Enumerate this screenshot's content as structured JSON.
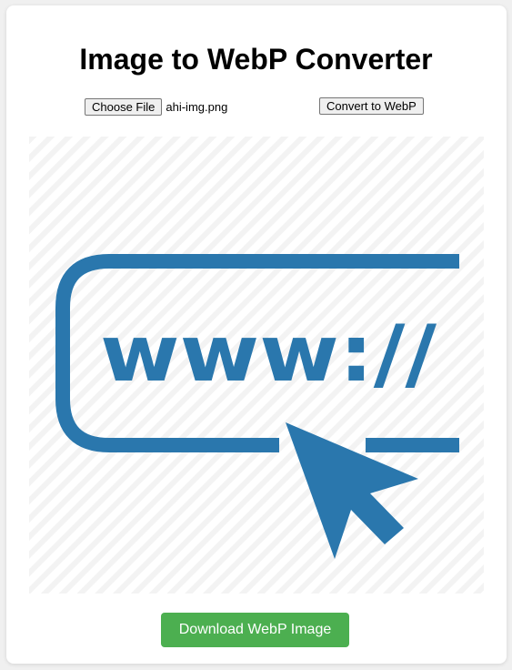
{
  "title": "Image to WebP Converter",
  "file_input": {
    "button_label": "Choose File",
    "file_name": "ahi-img.png"
  },
  "convert_button_label": "Convert to WebP",
  "preview": {
    "text": "www://",
    "icon_color": "#2a77ad"
  },
  "download_button_label": "Download WebP Image",
  "colors": {
    "download_button": "#4caf50",
    "page_background": "#f0f0f0",
    "card_background": "#ffffff"
  }
}
